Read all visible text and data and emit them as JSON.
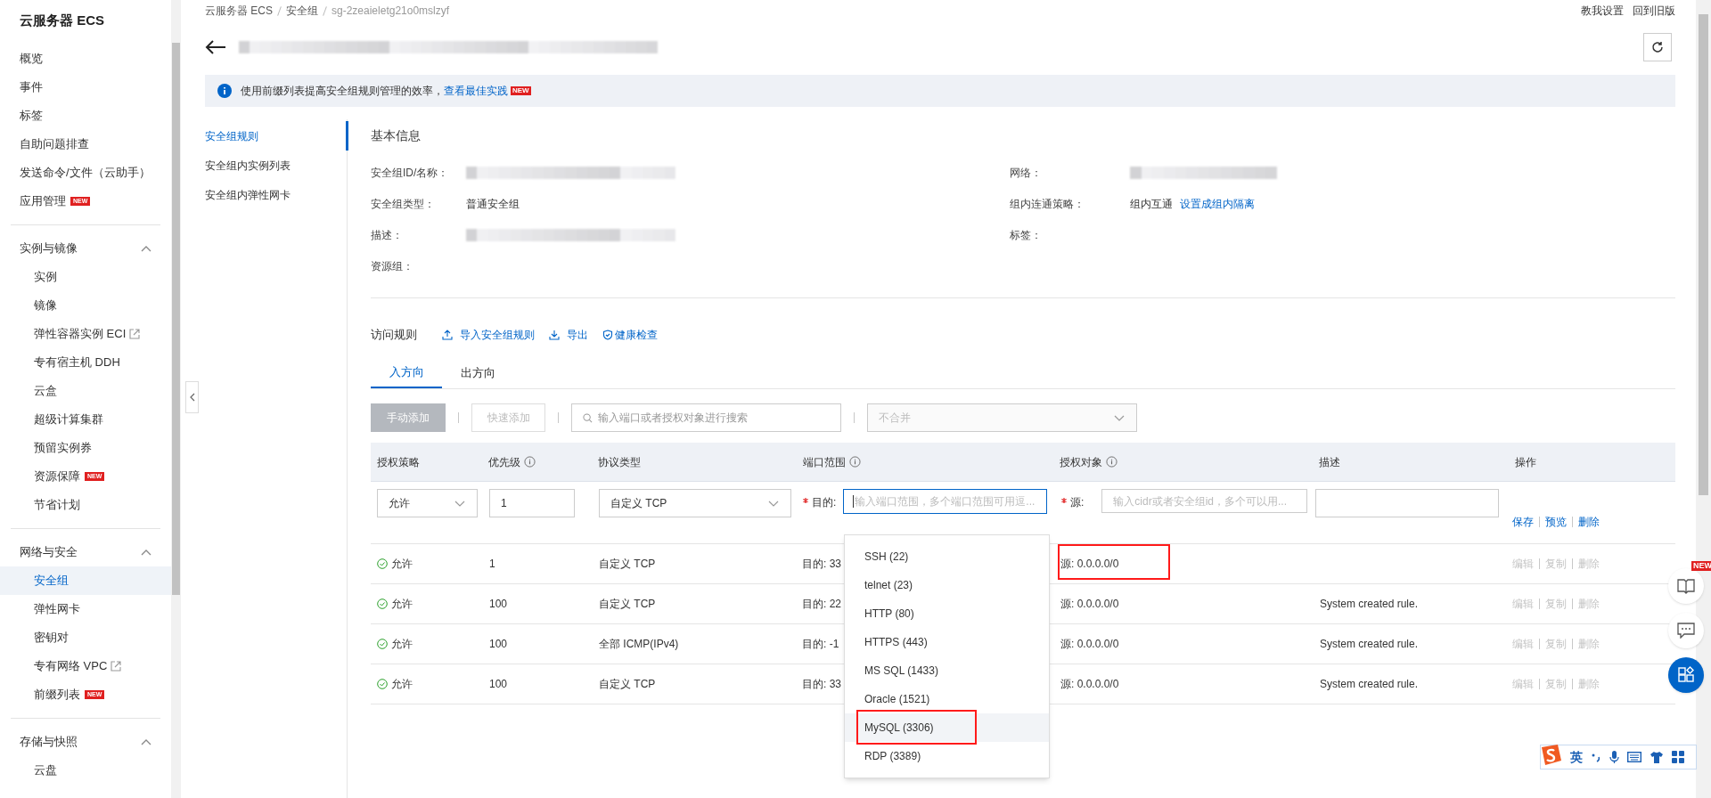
{
  "sidebar": {
    "title": "云服务器 ECS",
    "groups": [
      {
        "items": [
          {
            "label": "概览",
            "external": false,
            "selected": false
          },
          {
            "label": "事件",
            "external": false,
            "selected": false
          },
          {
            "label": "标签",
            "external": false,
            "selected": false
          },
          {
            "label": "自助问题排查",
            "external": false,
            "selected": false
          },
          {
            "label": "发送命令/文件（云助手）",
            "external": false,
            "selected": false
          },
          {
            "label": "应用管理",
            "badge": "NEW",
            "external": false,
            "selected": false
          }
        ]
      },
      {
        "title": "实例与镜像",
        "expanded": true,
        "items": [
          {
            "label": "实例",
            "external": false,
            "selected": false
          },
          {
            "label": "镜像",
            "external": false,
            "selected": false
          },
          {
            "label": "弹性容器实例 ECI",
            "external": true,
            "selected": false
          },
          {
            "label": "专有宿主机 DDH",
            "external": false,
            "selected": false
          },
          {
            "label": "云盒",
            "external": false,
            "selected": false
          },
          {
            "label": "超级计算集群",
            "external": false,
            "selected": false
          },
          {
            "label": "预留实例券",
            "external": false,
            "selected": false
          },
          {
            "label": "资源保障",
            "badge": "NEW",
            "external": false,
            "selected": false
          },
          {
            "label": "节省计划",
            "external": false,
            "selected": false
          }
        ]
      },
      {
        "title": "网络与安全",
        "expanded": true,
        "items": [
          {
            "label": "安全组",
            "external": false,
            "selected": true
          },
          {
            "label": "弹性网卡",
            "external": false,
            "selected": false
          },
          {
            "label": "密钥对",
            "external": false,
            "selected": false
          },
          {
            "label": "专有网络 VPC",
            "external": true,
            "selected": false
          },
          {
            "label": "前缀列表",
            "badge": "NEW",
            "external": false,
            "selected": false
          }
        ]
      },
      {
        "title": "存储与快照",
        "expanded": true,
        "items": [
          {
            "label": "云盘",
            "external": false,
            "selected": false
          }
        ]
      }
    ]
  },
  "breadcrumb": [
    "云服务器 ECS",
    "安全组",
    "sg-2zeaieletg21o0mslzyf"
  ],
  "top_links": [
    "教我设置",
    "回到旧版"
  ],
  "banner": {
    "text": "使用前缀列表提高安全组规则管理的效率，",
    "link": "查看最佳实践",
    "badge": "NEW"
  },
  "subnav": [
    {
      "label": "安全组规则",
      "selected": true
    },
    {
      "label": "安全组内实例列表",
      "selected": false
    },
    {
      "label": "安全组内弹性网卡",
      "selected": false
    }
  ],
  "basic_info": {
    "title": "基本信息",
    "left": [
      {
        "label": "安全组ID/名称：",
        "redacted": true
      },
      {
        "label": "安全组类型：",
        "value": "普通安全组",
        "redacted": false
      },
      {
        "label": "描述：",
        "redacted": true
      },
      {
        "label": "资源组：",
        "redacted": false
      }
    ],
    "right": [
      {
        "label": "网络：",
        "redacted": true
      },
      {
        "label": "组内连通策略：",
        "value": "组内互通",
        "link": "设置成组内隔离",
        "redacted": false
      },
      {
        "label": "标签：",
        "redacted": false
      }
    ]
  },
  "access_rules": {
    "title": "访问规则",
    "actions": [
      {
        "kind": "upload",
        "label": "导入安全组规则"
      },
      {
        "kind": "download",
        "label": "导出"
      },
      {
        "kind": "shield",
        "label": "健康检查"
      }
    ]
  },
  "tabs": [
    {
      "label": "入方向",
      "selected": true
    },
    {
      "label": "出方向",
      "selected": false
    }
  ],
  "toolbar": {
    "manual_add": {
      "label": "手动添加",
      "disabled": true
    },
    "quick_add": {
      "label": "快速添加",
      "disabled": true
    },
    "search": {
      "placeholder": "输入端口或者授权对象进行搜索"
    },
    "merge": {
      "value": "不合并",
      "disabled": true
    }
  },
  "columns": [
    {
      "label": "授权策略",
      "info": false
    },
    {
      "label": "优先级",
      "info": true
    },
    {
      "label": "协议类型",
      "info": false
    },
    {
      "label": "端口范围",
      "info": true
    },
    {
      "label": "授权对象",
      "info": true
    },
    {
      "label": "描述",
      "info": false
    },
    {
      "label": "操作",
      "info": false
    }
  ],
  "edit_row": {
    "policy": "允许",
    "priority": "1",
    "protocol": "自定义 TCP",
    "port_label": "目的:",
    "port_placeholder": "输入端口范围，多个端口范围可用逗...",
    "source_label": "源:",
    "source_placeholder": "输入cidr或者安全组id，多个可以用...",
    "actions": [
      "保存",
      "预览",
      "删除"
    ]
  },
  "port_dropdown": [
    {
      "label": "SSH (22)",
      "hovered": false,
      "highlighted": false
    },
    {
      "label": "telnet (23)",
      "hovered": false,
      "highlighted": false
    },
    {
      "label": "HTTP (80)",
      "hovered": false,
      "highlighted": false
    },
    {
      "label": "HTTPS (443)",
      "hovered": false,
      "highlighted": false
    },
    {
      "label": "MS SQL (1433)",
      "hovered": false,
      "highlighted": false
    },
    {
      "label": "Oracle (1521)",
      "hovered": false,
      "highlighted": false
    },
    {
      "label": "MySQL (3306)",
      "hovered": true,
      "highlighted": true
    },
    {
      "label": "RDP (3389)",
      "hovered": false,
      "highlighted": false
    }
  ],
  "rows": [
    {
      "policy": "允许",
      "priority": "1",
      "protocol": "自定义 TCP",
      "port": "目的: 33",
      "source": "源: 0.0.0.0/0",
      "highlighted": true,
      "actions": [
        "编辑",
        "复制",
        "删除"
      ],
      "actions_disabled": true
    },
    {
      "policy": "允许",
      "priority": "100",
      "protocol": "自定义 TCP",
      "port": "目的: 22",
      "source": "源: 0.0.0.0/0",
      "description": "System created rule.",
      "highlighted": false,
      "actions": [
        "编辑",
        "复制",
        "删除"
      ],
      "actions_disabled": true
    },
    {
      "policy": "允许",
      "priority": "100",
      "protocol": "全部 ICMP(IPv4)",
      "port": "目的: -1",
      "source": "源: 0.0.0.0/0",
      "description": "System created rule.",
      "highlighted": false,
      "actions": [
        "编辑",
        "复制",
        "删除"
      ],
      "actions_disabled": true
    },
    {
      "policy": "允许",
      "priority": "100",
      "protocol": "自定义 TCP",
      "port": "目的: 33",
      "source": "源: 0.0.0.0/0",
      "description": "System created rule.",
      "highlighted": false,
      "actions": [
        "编辑",
        "复制",
        "删除"
      ],
      "actions_disabled": true
    }
  ],
  "float_buttons": [
    {
      "kind": "guide",
      "badge": "NEW"
    },
    {
      "kind": "chat"
    },
    {
      "kind": "apps"
    }
  ],
  "ime": {
    "mode": "英"
  }
}
